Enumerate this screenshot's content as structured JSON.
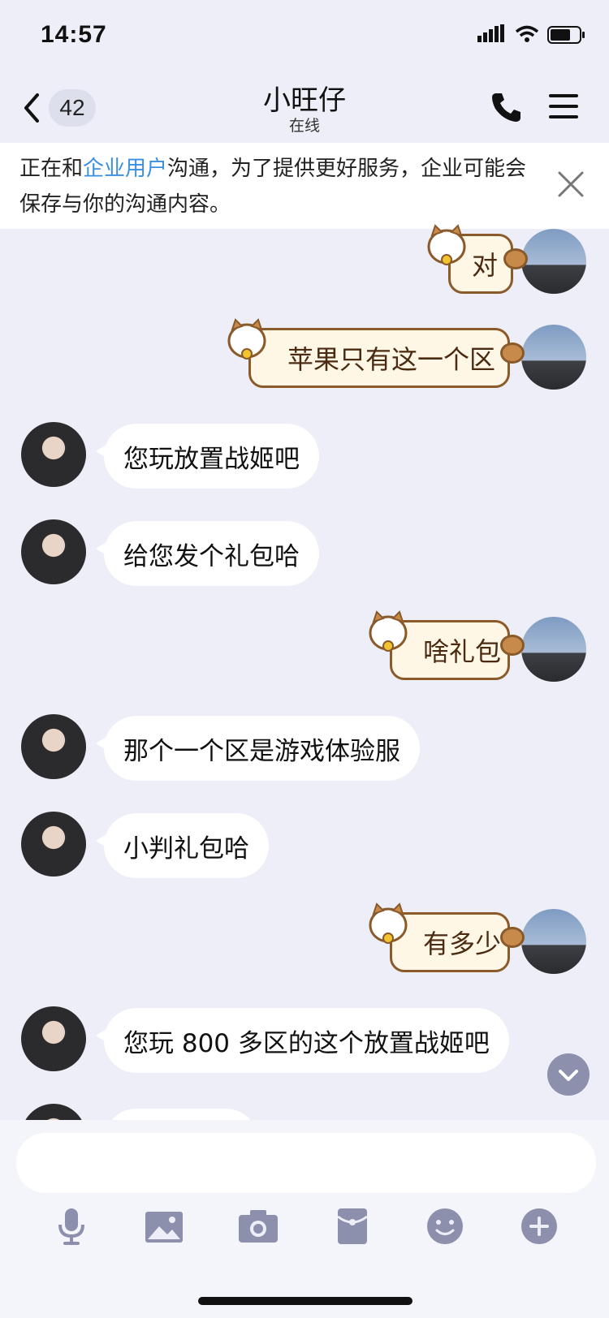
{
  "status_bar": {
    "time": "14:57"
  },
  "header": {
    "back_count": "42",
    "title": "小旺仔",
    "subtitle": "在线"
  },
  "notice": {
    "text_before": "正在和",
    "highlight": "企业用户",
    "text_after": "沟通，为了提供更好服务，企业可能会保存与你的沟通内容。"
  },
  "messages": [
    {
      "side": "right",
      "text": "对"
    },
    {
      "side": "right",
      "text": "苹果只有这一个区"
    },
    {
      "side": "left",
      "text": "您玩放置战姬吧"
    },
    {
      "side": "left",
      "text": "给您发个礼包哈"
    },
    {
      "side": "right",
      "text": "啥礼包"
    },
    {
      "side": "left",
      "text": "那个一个区是游戏体验服"
    },
    {
      "side": "left",
      "text": "小判礼包哈"
    },
    {
      "side": "right",
      "text": "有多少"
    },
    {
      "side": "left",
      "text": "您玩 800 多区的这个放置战姬吧"
    }
  ],
  "input": {
    "placeholder": ""
  },
  "toolbar": {
    "icons": [
      "microphone-icon",
      "image-icon",
      "camera-icon",
      "red-packet-icon",
      "emoji-icon",
      "plus-icon"
    ]
  },
  "colors": {
    "background": "#EDEEF7",
    "highlight": "#3A8FE0",
    "cat_border": "#8A5A2B"
  }
}
